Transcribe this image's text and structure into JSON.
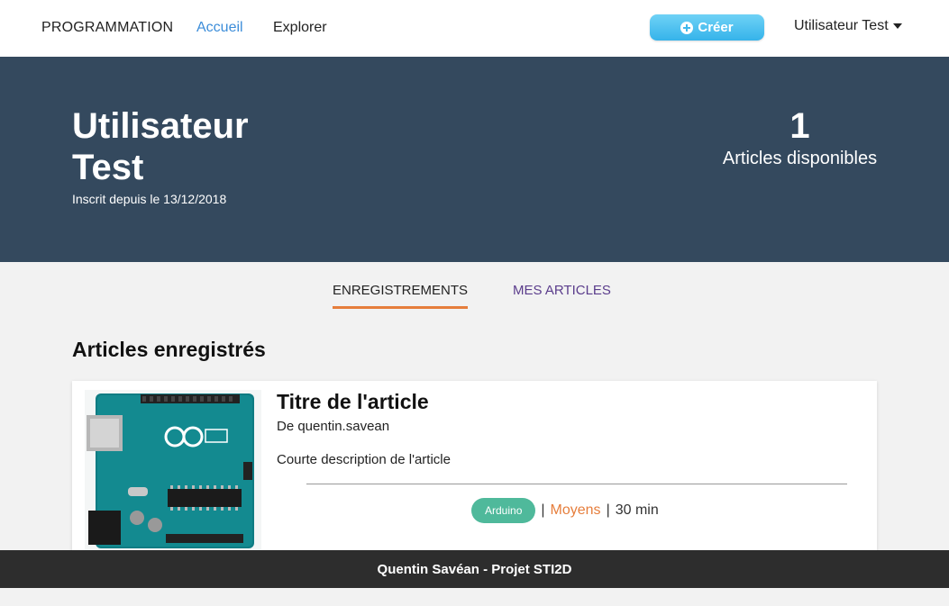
{
  "navbar": {
    "brand": "PROGRAMMATION",
    "links": [
      {
        "label": "Accueil"
      },
      {
        "label": "Explorer"
      }
    ],
    "create_label": "Créer",
    "user_label": "Utilisateur Test",
    "accent": "#3c8dd9"
  },
  "hero": {
    "name": "Utilisateur Test",
    "since": "Inscrit depuis le 13/12/2018",
    "count": "1",
    "count_label": "Articles disponibles",
    "background": "#34495e"
  },
  "tabs": [
    {
      "label": "ENREGISTREMENTS",
      "active": true
    },
    {
      "label": "MES ARTICLES",
      "active": false
    }
  ],
  "section": {
    "title": "Articles enregistrés"
  },
  "articles": [
    {
      "title": "Titre de l'article",
      "author": "De quentin.savean",
      "description": "Courte description de l'article",
      "tag": "Arduino",
      "difficulty": "Moyens",
      "duration": "30 min",
      "image_icon": "arduino-board-image"
    }
  ],
  "footer": {
    "text": "Quentin Savéan - Projet STI2D"
  },
  "colors": {
    "hero_bg": "#34495e",
    "tab_underline": "#e67e3c",
    "tag_bg": "#4fb99b",
    "footer_bg": "#2d2d2d",
    "create_btn": "#35b3ea"
  }
}
